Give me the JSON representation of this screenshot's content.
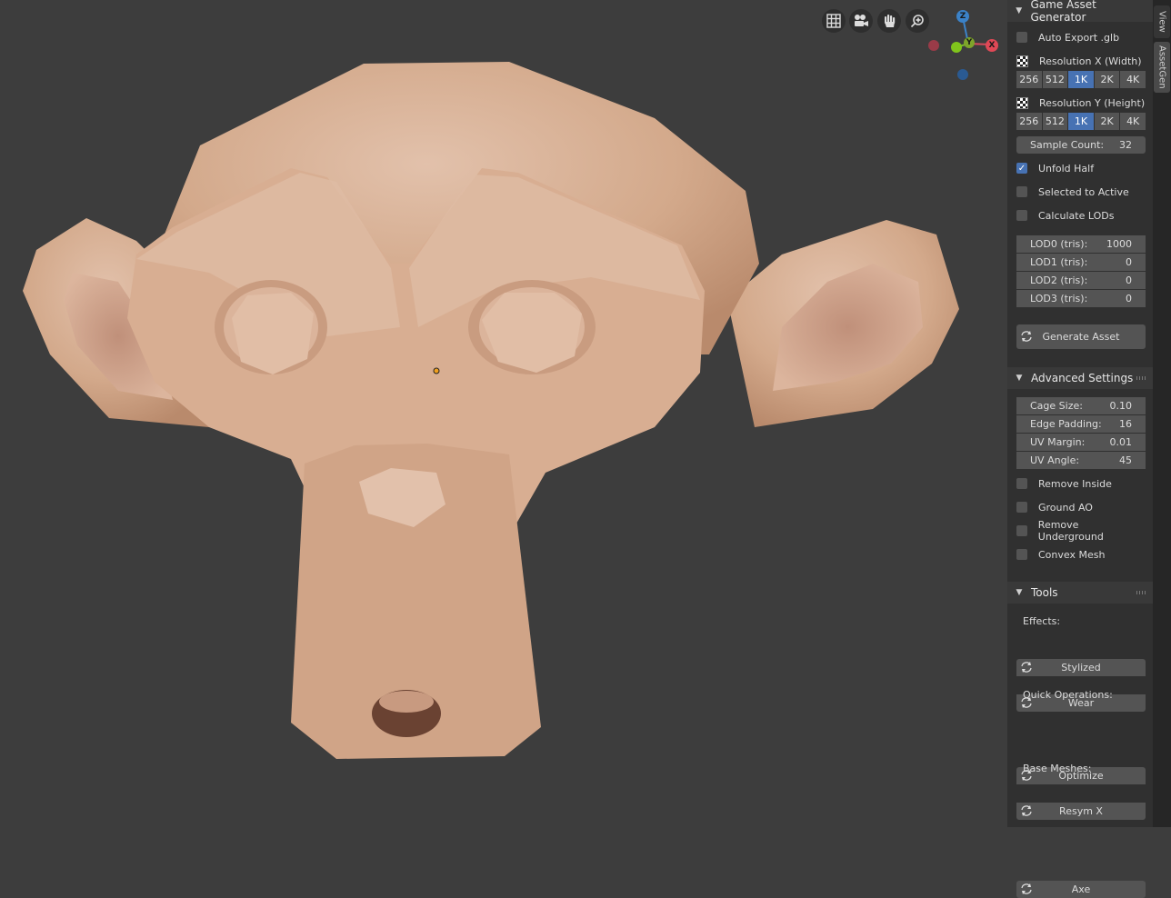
{
  "viewport": {
    "nav_icons": [
      "grid-icon",
      "camera-icon",
      "hand-icon",
      "zoom-icon"
    ],
    "gizmo": {
      "z": "Z",
      "y": "Y",
      "x": "X"
    }
  },
  "tabs": [
    "View",
    "AssetGen"
  ],
  "game_asset_generator": {
    "title": "Game Asset Generator",
    "auto_export": {
      "label": "Auto Export .glb",
      "checked": false
    },
    "resolution_x": {
      "label": "Resolution X (Width)",
      "options": [
        "256",
        "512",
        "1K",
        "2K",
        "4K"
      ],
      "selected": "1K"
    },
    "resolution_y": {
      "label": "Resolution Y (Height)",
      "options": [
        "256",
        "512",
        "1K",
        "2K",
        "4K"
      ],
      "selected": "1K"
    },
    "sample_count": {
      "label": "Sample Count:",
      "value": "32"
    },
    "unfold_half": {
      "label": "Unfold Half",
      "checked": true
    },
    "selected_to_active": {
      "label": "Selected to Active",
      "checked": false
    },
    "calculate_lods": {
      "label": "Calculate LODs",
      "checked": false
    },
    "lods": [
      {
        "label": "LOD0 (tris):",
        "value": "1000"
      },
      {
        "label": "LOD1 (tris):",
        "value": "0"
      },
      {
        "label": "LOD2 (tris):",
        "value": "0"
      },
      {
        "label": "LOD3 (tris):",
        "value": "0"
      }
    ],
    "generate_button": "Generate Asset"
  },
  "advanced_settings": {
    "title": "Advanced Settings",
    "fields": [
      {
        "label": "Cage Size:",
        "value": "0.10"
      },
      {
        "label": "Edge Padding:",
        "value": "16"
      },
      {
        "label": "UV Margin:",
        "value": "0.01"
      },
      {
        "label": "UV Angle:",
        "value": "45"
      }
    ],
    "checkboxes": [
      {
        "label": "Remove Inside",
        "checked": false
      },
      {
        "label": "Ground AO",
        "checked": false
      },
      {
        "label": "Remove Underground",
        "checked": false
      },
      {
        "label": "Convex Mesh",
        "checked": false
      }
    ]
  },
  "tools": {
    "title": "Tools",
    "effects_label": "Effects:",
    "effects": [
      "Stylized",
      "Wear"
    ],
    "quick_label": "Quick Operations:",
    "quick": [
      "Optimize",
      "Resym X"
    ],
    "base_label": "Base Meshes:",
    "base": [
      "Axe"
    ]
  },
  "colors": {
    "accent": "#4772b3",
    "skin": "#d4a98a",
    "background": "#3d3d3d"
  }
}
